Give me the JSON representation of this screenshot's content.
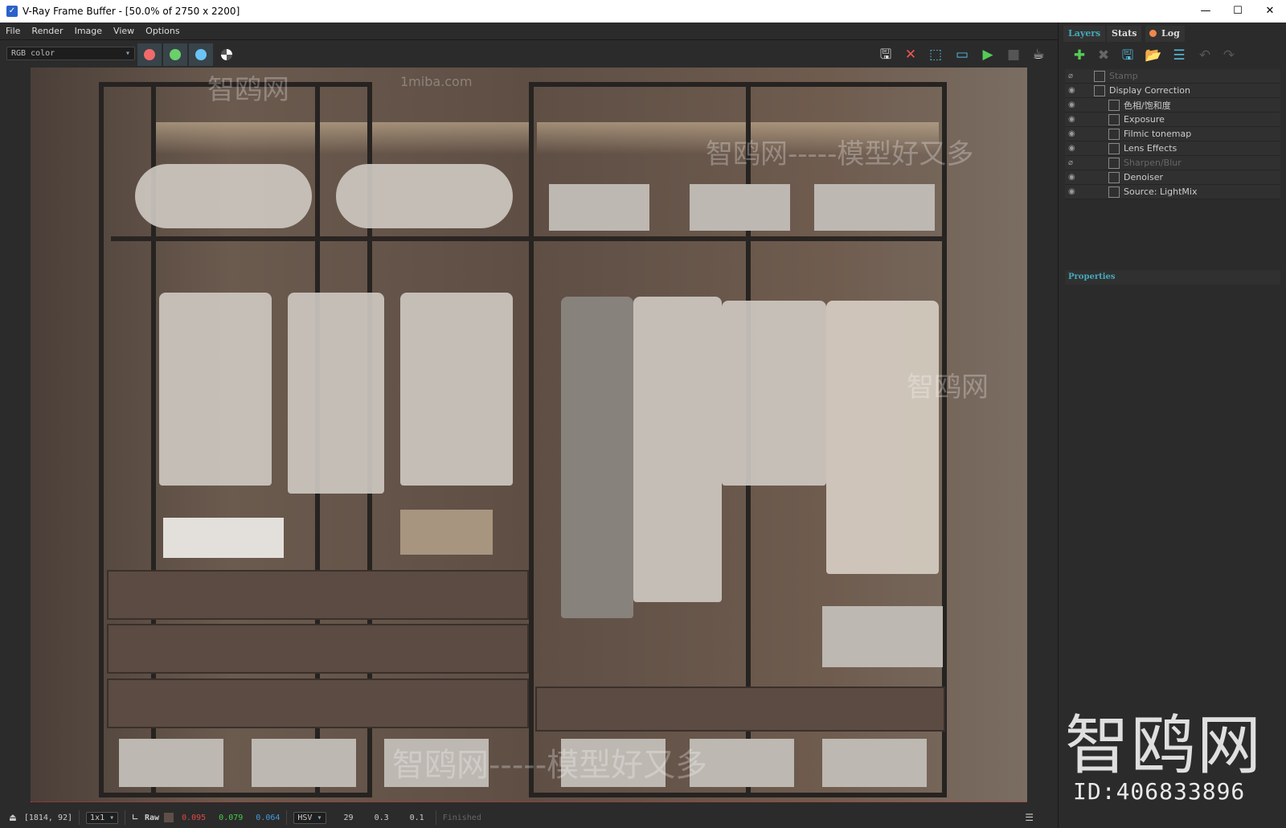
{
  "window": {
    "title": "V-Ray Frame Buffer - [50.0% of 2750 x 2200]",
    "controls": [
      "—",
      "☐",
      "✕"
    ]
  },
  "menu": [
    "File",
    "Render",
    "Image",
    "View",
    "Options"
  ],
  "toolbar": {
    "channel": "RGB color",
    "colors": {
      "red": "#f06a6a",
      "green": "#6ad06a",
      "blue": "#6ac4f5"
    },
    "icons": [
      "save-icon",
      "clear-image-icon",
      "region-select-icon",
      "frame-icon",
      "render-icon",
      "stop-render-icon",
      "interactive-render-icon"
    ]
  },
  "panel": {
    "tabs": [
      "Layers",
      "Stats",
      "Log"
    ],
    "log_dot_color": "#f0884a",
    "layers": [
      {
        "name": "Stamp",
        "enabled": false,
        "indent": 0
      },
      {
        "name": "Display Correction",
        "enabled": true,
        "indent": 0
      },
      {
        "name": "色相/饱和度",
        "enabled": true,
        "indent": 1
      },
      {
        "name": "Exposure",
        "enabled": true,
        "indent": 1
      },
      {
        "name": "Filmic tonemap",
        "enabled": true,
        "indent": 1
      },
      {
        "name": "Lens Effects",
        "enabled": true,
        "indent": 1
      },
      {
        "name": "Sharpen/Blur",
        "enabled": false,
        "indent": 1
      },
      {
        "name": "Denoiser",
        "enabled": true,
        "indent": 1
      },
      {
        "name": "Source: LightMix",
        "enabled": true,
        "indent": 1
      }
    ],
    "properties_label": "Properties"
  },
  "status": {
    "coords": "[1814, 92]",
    "sampling": "1x1",
    "mode": "Raw",
    "r": "0.095",
    "g": "0.079",
    "b": "0.064",
    "colorspace": "HSV",
    "h": "29",
    "s": "0.3",
    "v": "0.1",
    "state": "Finished"
  },
  "watermark": {
    "text": "智鸥网",
    "id": "ID:406833896",
    "small": "1miba.com",
    "tagline": "智鸥网-----模型好又多"
  }
}
